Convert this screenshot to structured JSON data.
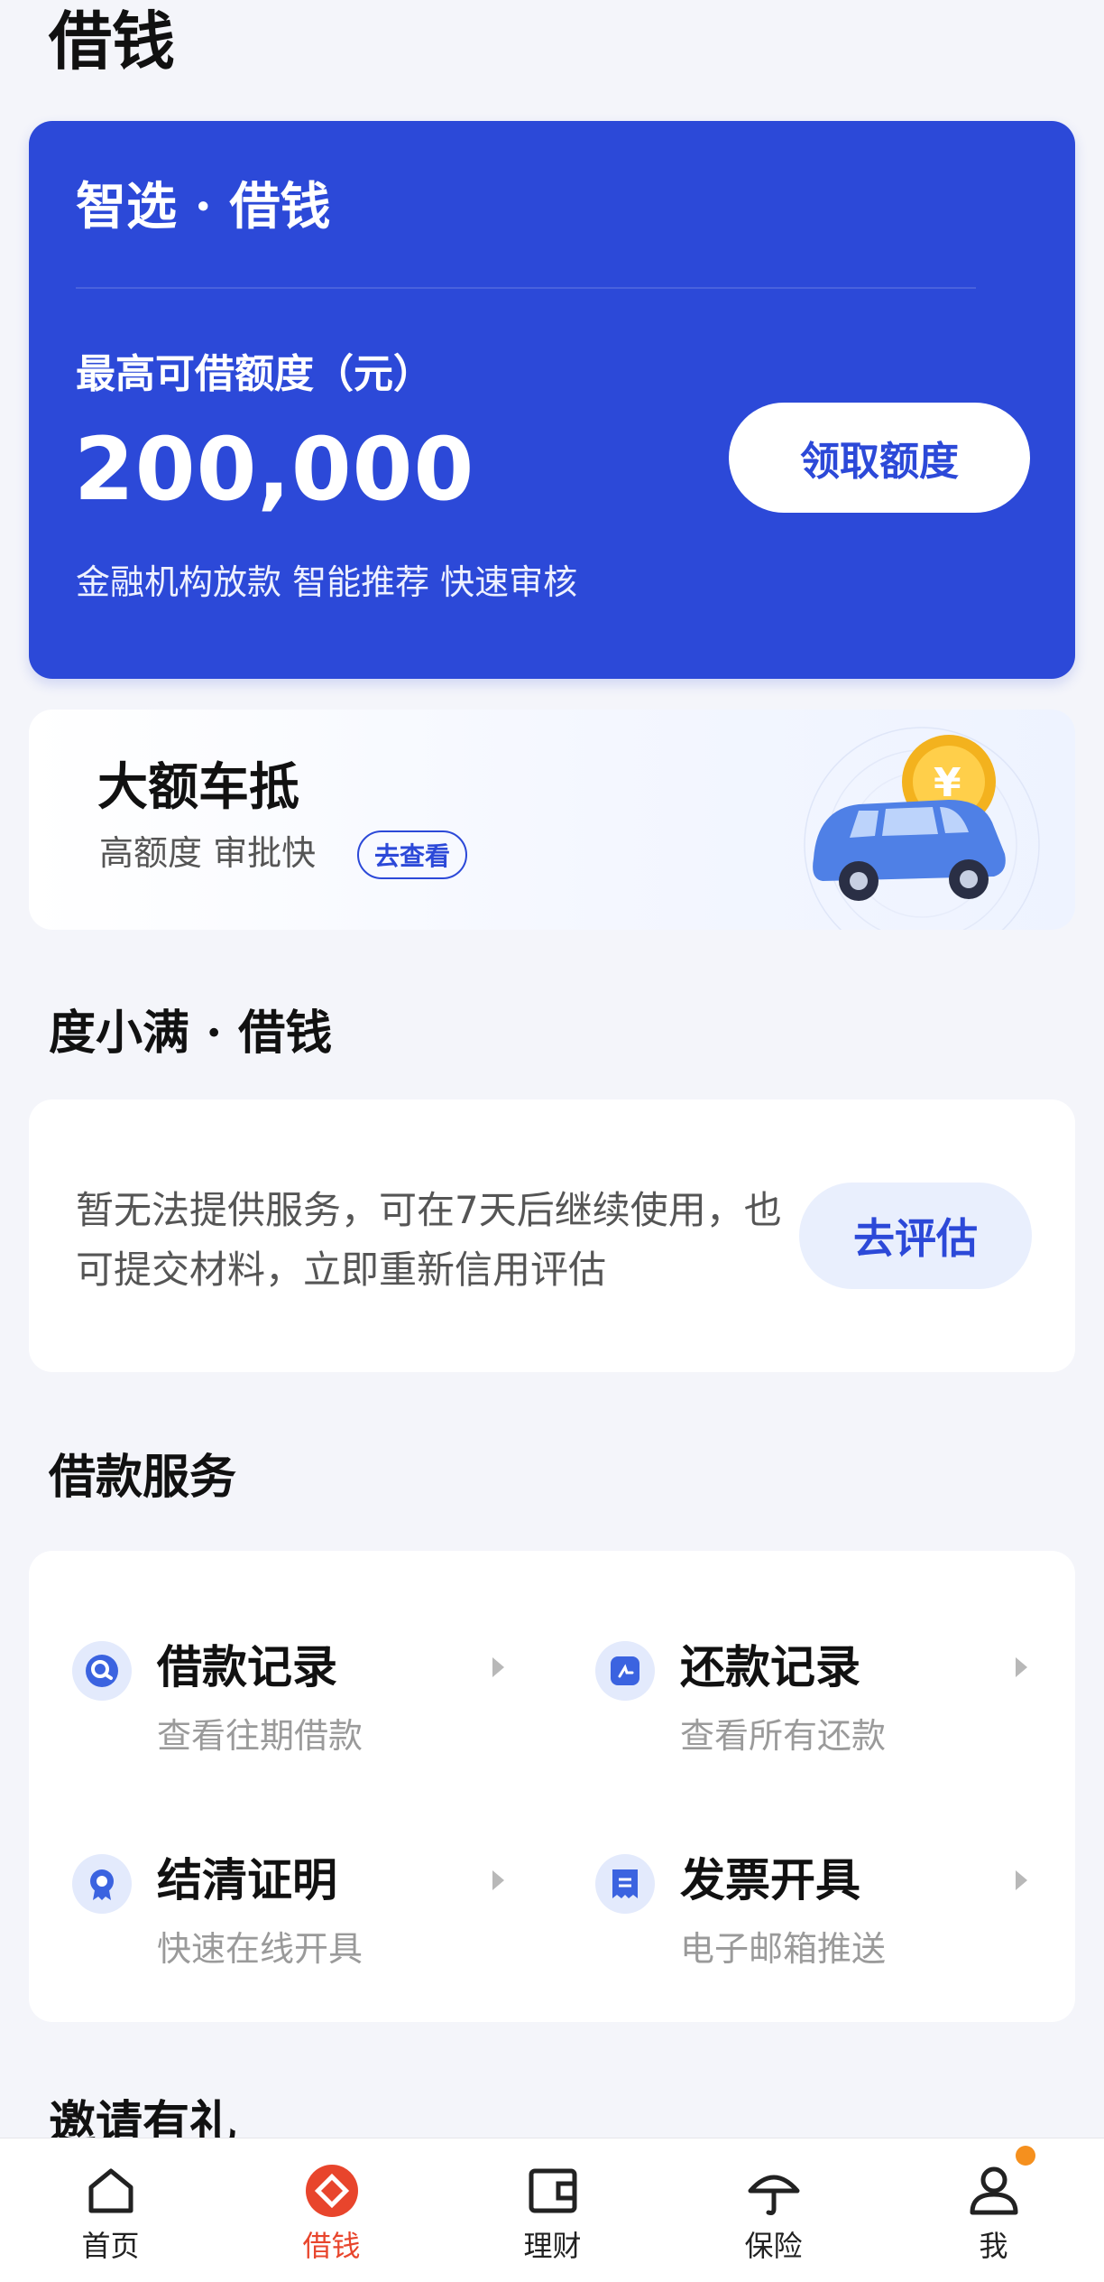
{
  "page": {
    "title": "借钱"
  },
  "hero": {
    "title": "智选 · 借钱",
    "limit_label": "最高可借额度（元）",
    "amount": "200,000",
    "description": "金融机构放款 智能推荐 快速审核",
    "button_label": "领取额度"
  },
  "banner": {
    "title": "大额车抵",
    "subtitle": "高额度 审批快",
    "tag": "去查看",
    "coin_symbol": "¥"
  },
  "duxiaoman": {
    "section_title": "度小满 · 借钱",
    "notice": "暂无法提供服务，可在7天后继续使用，也可提交材料，立即重新信用评估",
    "button_label": "去评估"
  },
  "services": {
    "section_title": "借款服务",
    "items": [
      {
        "title": "借款记录",
        "subtitle": "查看往期借款",
        "icon": "search-record-icon"
      },
      {
        "title": "还款记录",
        "subtitle": "查看所有还款",
        "icon": "repay-record-icon"
      },
      {
        "title": "结清证明",
        "subtitle": "快速在线开具",
        "icon": "certificate-icon"
      },
      {
        "title": "发票开具",
        "subtitle": "电子邮箱推送",
        "icon": "invoice-icon"
      }
    ]
  },
  "invite": {
    "section_title": "邀请有礼"
  },
  "tabbar": {
    "items": [
      {
        "label": "首页",
        "icon": "home-icon"
      },
      {
        "label": "借钱",
        "icon": "borrow-icon",
        "active": true
      },
      {
        "label": "理财",
        "icon": "wallet-icon"
      },
      {
        "label": "保险",
        "icon": "umbrella-icon"
      },
      {
        "label": "我",
        "icon": "user-icon",
        "badge": true
      }
    ]
  },
  "colors": {
    "brand_blue": "#2c49d8",
    "active_red": "#e8452c",
    "badge_orange": "#f5901e",
    "background": "#f4f5fa"
  }
}
